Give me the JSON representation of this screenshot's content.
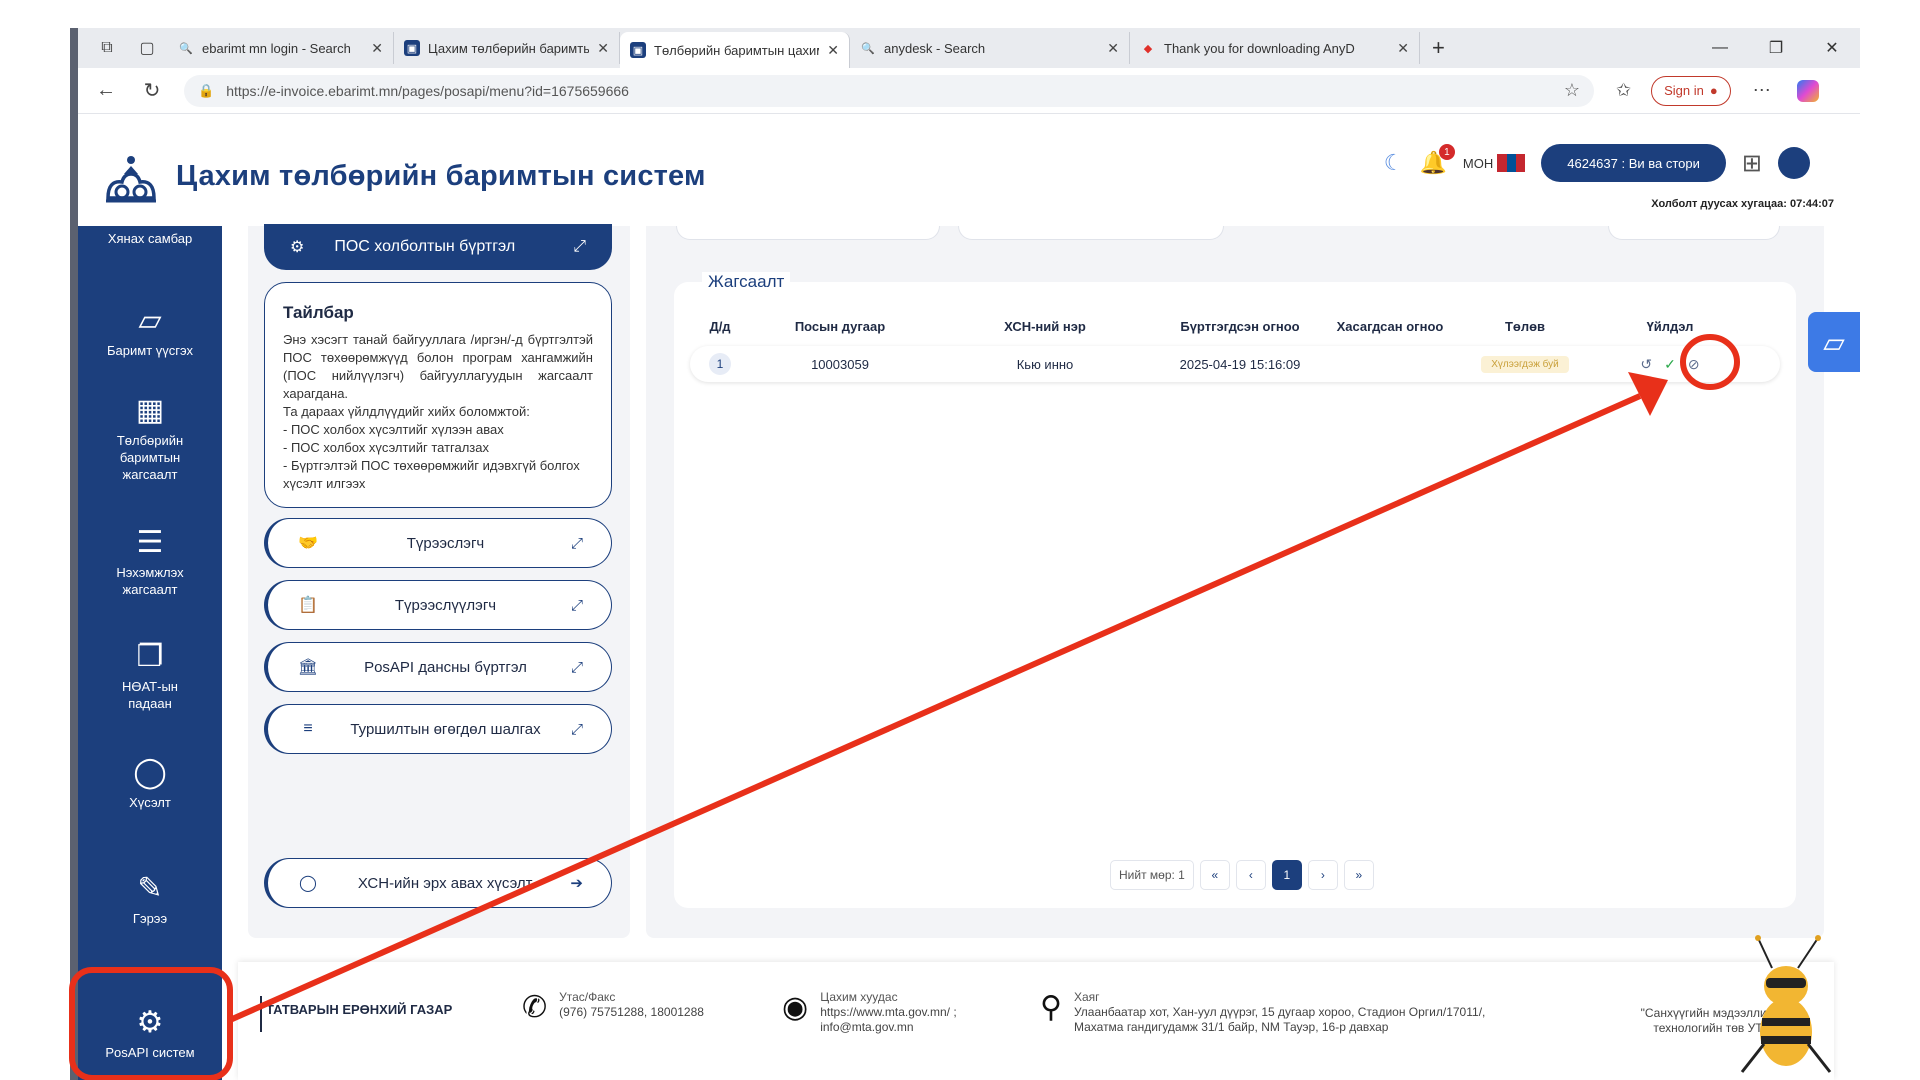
{
  "browser": {
    "tabs": [
      {
        "title": "ebarimt mn login - Search",
        "favicon": "search-icon",
        "active": false
      },
      {
        "title": "Цахим төлбөрийн баримтын си",
        "favicon": "site-icon",
        "active": false
      },
      {
        "title": "Төлбөрийн баримтын цахим си",
        "favicon": "site-icon",
        "active": true
      },
      {
        "title": "anydesk - Search",
        "favicon": "search-icon",
        "active": false
      },
      {
        "title": "Thank you for downloading AnyD",
        "favicon": "anydesk-icon",
        "active": false
      }
    ],
    "url": "https://e-invoice.ebarimt.mn/pages/posapi/menu?id=1675659666",
    "sign_in": "Sign in"
  },
  "header": {
    "title": "Цахим төлбөрийн баримтын систем",
    "language": "МОН",
    "notification_count": "1",
    "user": "4624637 : Ви ва стори",
    "session": "Холболт дуусах хугацаа: 07:44:07"
  },
  "sidebar": {
    "items": [
      {
        "label": "Хянах самбар",
        "icon": "dashboard-icon"
      },
      {
        "label": "Баримт үүсгэх",
        "icon": "receipt-icon"
      },
      {
        "label": "Төлбөрийн баримтын жагсаалт",
        "icon": "qr-icon"
      },
      {
        "label": "Нэхэмжлэх жагсаалт",
        "icon": "invoice-list-icon"
      },
      {
        "label": "НӨАТ-ын падаан",
        "icon": "vat-icon"
      },
      {
        "label": "Хүсэлт",
        "icon": "chat-icon"
      },
      {
        "label": "Гэрээ",
        "icon": "contract-icon"
      },
      {
        "label": "PosAPI систем",
        "icon": "gear-icon"
      }
    ]
  },
  "left_panel": {
    "register_button": "ПОС холболтын бүртгэл",
    "description_title": "Тайлбар",
    "description_text": "Энэ хэсэгт танай байгууллага /иргэн/-д бүртгэлтэй ПОС төхөөрөмжүүд болон програм хангамжийн (ПОС нийлүүлэгч) байгууллагуудын жагсаалт харагдана.",
    "description_lead": "Та дараах үйлдлүүдийг хийх боломжтой:",
    "description_items": [
      "- ПОС холбох хүсэлтийг хүлээн авах",
      "- ПОС холбох хүсэлтийг татгалзах",
      "- Бүртгэлтэй ПОС төхөөрөмжийг идэвхгүй болгох хүсэлт илгээх"
    ],
    "menu": [
      {
        "label": "Түрээслэгч",
        "icon": "handshake-icon"
      },
      {
        "label": "Түрээслүүлэгч",
        "icon": "clipboard-icon"
      },
      {
        "label": "PosAPI дансны бүртгэл",
        "icon": "bank-icon"
      },
      {
        "label": "Туршилтын өгөгдөл шалгах",
        "icon": "database-icon"
      }
    ],
    "request_button": "ХСН-ийн эрх авах хүсэлт"
  },
  "main": {
    "section_title": "Жагсаалт",
    "columns": [
      "Д/д",
      "Посын дугаар",
      "ХСН-ний нэр",
      "Бүртгэгдсэн огноо",
      "Хасагдсан огноо",
      "Төлөв",
      "Үйлдэл"
    ],
    "rows": [
      {
        "idx": "1",
        "pos_number": "10003059",
        "name": "Кью инно",
        "registered": "2025-04-19 15:16:09",
        "removed": "",
        "status": "Хүлээгдэж буй"
      }
    ],
    "pagination": {
      "total": "Нийт мөр: 1",
      "current": "1"
    }
  },
  "footer": {
    "org": "ТАТВАРЫН ЕРӨНХИЙ ГАЗАР",
    "phone_label": "Утас/Факс",
    "phone": "(976) 75751288, 18001288",
    "web_label": "Цахим хуудас",
    "web": "https://www.mta.gov.mn/ ;",
    "email": "info@mta.gov.mn",
    "addr_label": "Хаяг",
    "addr": "Улаанбаатар хот, Хан-уул дүүрэг, 15 дугаар хороо, Стадион Оргил/17011/, Махатма гандигудамж 31/1 байр, NM Тауэр, 16-р давхар",
    "tagline": "\"Санхүүгийн мэдээллийн технологийн төв УТҮГ\""
  },
  "colors": {
    "brand": "#1c3f7d",
    "annotation": "#e8301a",
    "accept": "#2aa84a"
  }
}
